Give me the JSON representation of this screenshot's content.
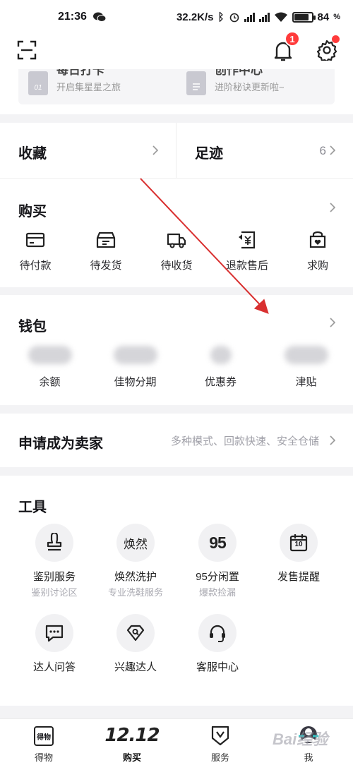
{
  "status_bar": {
    "time": "21:36",
    "speed": "32.2K/s",
    "battery": "84",
    "battery_level": 0.84
  },
  "header": {
    "notification_count": "1"
  },
  "top_cards": [
    {
      "title": "每日打卡",
      "subtitle": "开启集星星之旅",
      "icon_text": "01"
    },
    {
      "title": "创作中心",
      "subtitle": "进阶秘诀更新啦~"
    }
  ],
  "favorites": {
    "left_label": "收藏",
    "right_label": "足迹",
    "right_count": "6"
  },
  "buy": {
    "title": "购买",
    "items": [
      {
        "label": "待付款",
        "icon": "card-icon"
      },
      {
        "label": "待发货",
        "icon": "box-icon"
      },
      {
        "label": "待收货",
        "icon": "truck-icon"
      },
      {
        "label": "退款售后",
        "icon": "refund-icon"
      },
      {
        "label": "求购",
        "icon": "bag-heart-icon"
      }
    ]
  },
  "wallet": {
    "title": "钱包",
    "items": [
      {
        "label": "余额"
      },
      {
        "label": "佳物分期"
      },
      {
        "label": "优惠券"
      },
      {
        "label": "津贴"
      }
    ]
  },
  "seller": {
    "title": "申请成为卖家",
    "desc": "多种模式、回款快速、安全仓储"
  },
  "tools": {
    "title": "工具",
    "items": [
      {
        "label": "鉴别服务",
        "sub": "鉴别讨论区",
        "icon": "stamp-icon"
      },
      {
        "label": "焕然洗护",
        "sub": "专业洗鞋服务",
        "icon_text": "焕然"
      },
      {
        "label": "95分闲置",
        "sub": "爆款捡漏",
        "icon_text": "95"
      },
      {
        "label": "发售提醒",
        "sub": "",
        "icon": "calendar-icon",
        "icon_text": "10"
      },
      {
        "label": "达人问答",
        "sub": "",
        "icon": "chat-icon"
      },
      {
        "label": "兴趣达人",
        "sub": "",
        "icon": "diamond-search-icon"
      },
      {
        "label": "客服中心",
        "sub": "",
        "icon": "headset-icon"
      }
    ]
  },
  "tabbar": {
    "tabs": [
      {
        "label": "得物",
        "icon_text": "得物"
      },
      {
        "label": "购买",
        "icon_text": "12.12"
      },
      {
        "label": "服务"
      },
      {
        "label": "我"
      }
    ],
    "active": "购买"
  },
  "watermark": "Bai经验",
  "colors": {
    "accent_red": "#ff3b3b",
    "annotation_arrow": "#d93030",
    "background": "#f3f3f5"
  }
}
